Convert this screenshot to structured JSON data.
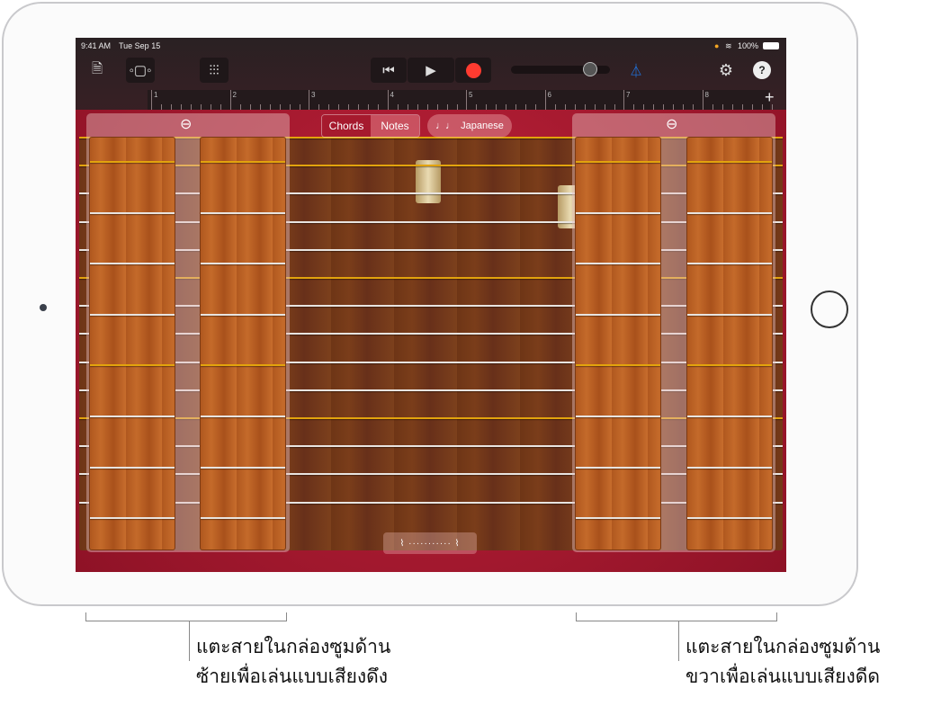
{
  "status": {
    "time": "9:41 AM",
    "date": "Tue Sep 15",
    "battery": "100%"
  },
  "toolbar": {
    "my_songs_icon": "document-icon",
    "view_icon": "tracks-view-icon",
    "mixer_icon": "sliders-icon",
    "rewind_icon": "skip-back-icon",
    "play_icon": "play-icon",
    "record_icon": "record-icon",
    "record_color": "#ff3b30",
    "metronome_color": "#1f7cf2",
    "volume": 0.8
  },
  "ruler": {
    "bars": [
      "1",
      "2",
      "3",
      "4",
      "5",
      "6",
      "7",
      "8"
    ],
    "add_label": "+"
  },
  "instrument": {
    "segment": {
      "chords": "Chords",
      "notes": "Notes",
      "selected": "Chords"
    },
    "scale_icon": "♩♩",
    "scale": "Japanese",
    "string_colors": {
      "gold": "#e2a30d",
      "silver": "#e8e4e0"
    },
    "main_strings": [
      "gold",
      "gold",
      "silver",
      "silver",
      "silver",
      "gold",
      "silver",
      "silver",
      "silver",
      "silver",
      "gold",
      "silver",
      "silver",
      "silver"
    ],
    "zoom_strings": [
      "gold",
      "silver",
      "silver",
      "silver",
      "gold",
      "silver",
      "silver",
      "silver"
    ],
    "handle_glyph": "⌇ ··········· ⌇"
  },
  "captions": {
    "left": [
      "แตะสายในกล่องซูมด้าน",
      "ซ้ายเพื่อเล่นแบบเสียงดึง"
    ],
    "right": [
      "แตะสายในกล่องซูมด้าน",
      "ขวาเพื่อเล่นแบบเสียงดีด"
    ]
  }
}
